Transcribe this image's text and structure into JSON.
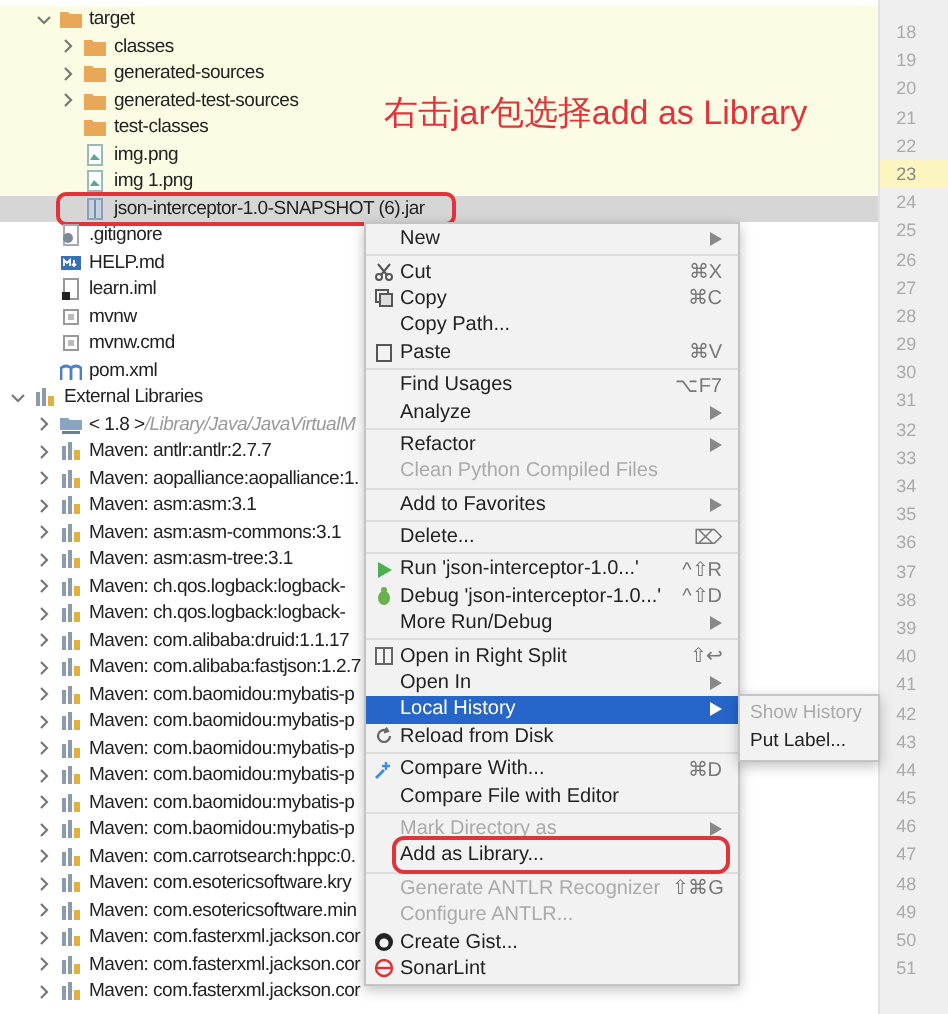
{
  "annotation": "右击jar包选择add as Library",
  "project_files": [
    {
      "label": "target",
      "kind": "folder",
      "expanded": true,
      "tinted": true,
      "selected": false,
      "children": [
        {
          "label": "classes",
          "kind": "folder",
          "expanded": false,
          "selected": false
        },
        {
          "label": "generated-sources",
          "kind": "folder",
          "expanded": false,
          "selected": false
        },
        {
          "label": "generated-test-sources",
          "kind": "folder",
          "expanded": false,
          "selected": false
        },
        {
          "label": "test-classes",
          "kind": "folder",
          "selected": false
        },
        {
          "label": "img.png",
          "kind": "image",
          "selected": false
        },
        {
          "label": "img 1.png",
          "kind": "image",
          "selected": false
        },
        {
          "label": "json-interceptor-1.0-SNAPSHOT (6).jar",
          "kind": "archive",
          "selected": true,
          "boxed": true
        }
      ]
    },
    {
      "label": ".gitignore",
      "kind": "gitignore",
      "selected": false
    },
    {
      "label": "HELP.md",
      "kind": "markdown",
      "selected": false
    },
    {
      "label": "learn.iml",
      "kind": "iml",
      "selected": false
    },
    {
      "label": "mvnw",
      "kind": "file",
      "selected": false
    },
    {
      "label": "mvnw.cmd",
      "kind": "file",
      "selected": false
    },
    {
      "label": "pom.xml",
      "kind": "maven",
      "selected": false
    }
  ],
  "external_libraries": {
    "label": "External Libraries",
    "kind": "libraries",
    "expanded": true,
    "selected": false,
    "children": [
      {
        "label": "< 1.8 >",
        "detail": "/Library/Java/JavaVirtualM",
        "kind": "jdk",
        "expanded": false,
        "selected": false
      },
      {
        "label": "Maven: antlr:antlr:2.7.7",
        "kind": "library",
        "expanded": false,
        "selected": false
      },
      {
        "label": "Maven: aopalliance:aopalliance:1.",
        "kind": "library",
        "expanded": false,
        "selected": false
      },
      {
        "label": "Maven: asm:asm:3.1",
        "kind": "library",
        "expanded": false,
        "selected": false
      },
      {
        "label": "Maven: asm:asm-commons:3.1",
        "kind": "library",
        "expanded": false,
        "selected": false
      },
      {
        "label": "Maven: asm:asm-tree:3.1",
        "kind": "library",
        "expanded": false,
        "selected": false
      },
      {
        "label": "Maven: ch.qos.logback:logback-",
        "kind": "library",
        "expanded": false,
        "selected": false
      },
      {
        "label": "Maven: ch.qos.logback:logback-",
        "kind": "library",
        "expanded": false,
        "selected": false
      },
      {
        "label": "Maven: com.alibaba:druid:1.1.17",
        "kind": "library",
        "expanded": false,
        "selected": false
      },
      {
        "label": "Maven: com.alibaba:fastjson:1.2.7",
        "kind": "library",
        "expanded": false,
        "selected": false
      },
      {
        "label": "Maven: com.baomidou:mybatis-p",
        "kind": "library",
        "expanded": false,
        "selected": false
      },
      {
        "label": "Maven: com.baomidou:mybatis-p",
        "kind": "library",
        "expanded": false,
        "selected": false
      },
      {
        "label": "Maven: com.baomidou:mybatis-p",
        "kind": "library",
        "expanded": false,
        "selected": false
      },
      {
        "label": "Maven: com.baomidou:mybatis-p",
        "kind": "library",
        "expanded": false,
        "selected": false
      },
      {
        "label": "Maven: com.baomidou:mybatis-p",
        "kind": "library",
        "expanded": false,
        "selected": false
      },
      {
        "label": "Maven: com.baomidou:mybatis-p",
        "kind": "library",
        "expanded": false,
        "selected": false
      },
      {
        "label": "Maven: com.carrotsearch:hppc:0.",
        "kind": "library",
        "expanded": false,
        "selected": false
      },
      {
        "label": "Maven: com.esotericsoftware.kry",
        "kind": "library",
        "expanded": false,
        "selected": false
      },
      {
        "label": "Maven: com.esotericsoftware.min",
        "kind": "library",
        "expanded": false,
        "selected": false
      },
      {
        "label": "Maven: com.fasterxml.jackson.cor",
        "kind": "library",
        "expanded": false,
        "selected": false
      },
      {
        "label": "Maven: com.fasterxml.jackson.cor",
        "kind": "library",
        "expanded": false,
        "selected": false
      },
      {
        "label": "Maven: com.fasterxml.jackson.cor",
        "kind": "library",
        "expanded": false,
        "selected": false
      }
    ]
  },
  "line_numbers": [
    {
      "n": "18",
      "current": false
    },
    {
      "n": "19",
      "current": false
    },
    {
      "n": "20",
      "current": false
    },
    {
      "n": "21",
      "current": false
    },
    {
      "n": "22",
      "current": false
    },
    {
      "n": "23",
      "current": true
    },
    {
      "n": "24",
      "current": false
    },
    {
      "n": "25",
      "current": false
    },
    {
      "n": "26",
      "current": false
    },
    {
      "n": "27",
      "current": false
    },
    {
      "n": "28",
      "current": false
    },
    {
      "n": "29",
      "current": false
    },
    {
      "n": "30",
      "current": false
    },
    {
      "n": "31",
      "current": false
    },
    {
      "n": "32",
      "current": false
    },
    {
      "n": "33",
      "current": false
    },
    {
      "n": "34",
      "current": false
    },
    {
      "n": "35",
      "current": false
    },
    {
      "n": "36",
      "current": false
    },
    {
      "n": "37",
      "current": false
    },
    {
      "n": "38",
      "current": false
    },
    {
      "n": "39",
      "current": false
    },
    {
      "n": "40",
      "current": false
    },
    {
      "n": "41",
      "current": false
    },
    {
      "n": "42",
      "current": false
    },
    {
      "n": "43",
      "current": false
    },
    {
      "n": "44",
      "current": false
    },
    {
      "n": "45",
      "current": false
    },
    {
      "n": "46",
      "current": false
    },
    {
      "n": "47",
      "current": false
    },
    {
      "n": "48",
      "current": false
    },
    {
      "n": "49",
      "current": false
    },
    {
      "n": "50",
      "current": false
    },
    {
      "n": "51",
      "current": false
    }
  ],
  "context_menu": [
    [
      {
        "label": "New",
        "submenu": true,
        "selected": false
      }
    ],
    [
      {
        "label": "Cut",
        "kind": "scissors",
        "shortcut": "⌘X",
        "selected": false
      },
      {
        "label": "Copy",
        "kind": "copy",
        "shortcut": "⌘C",
        "selected": false
      },
      {
        "label": "Copy Path...",
        "selected": false
      },
      {
        "label": "Paste",
        "kind": "paste",
        "shortcut": "⌘V",
        "selected": false
      }
    ],
    [
      {
        "label": "Find Usages",
        "shortcut": "⌥F7",
        "selected": false
      },
      {
        "label": "Analyze",
        "submenu": true,
        "selected": false
      }
    ],
    [
      {
        "label": "Refactor",
        "submenu": true,
        "selected": false
      },
      {
        "label": "Clean Python Compiled Files",
        "disabled": true,
        "selected": false
      }
    ],
    [
      {
        "label": "Add to Favorites",
        "submenu": true,
        "selected": false
      }
    ],
    [
      {
        "label": "Delete...",
        "shortcut": "⌦",
        "selected": false
      }
    ],
    [
      {
        "label": "Run 'json-interceptor-1.0...'",
        "kind": "run",
        "shortcut": "^⇧R",
        "selected": false
      },
      {
        "label": "Debug 'json-interceptor-1.0...'",
        "kind": "bug",
        "shortcut": "^⇧D",
        "selected": false
      },
      {
        "label": "More Run/Debug",
        "submenu": true,
        "selected": false
      }
    ],
    [
      {
        "label": "Open in Right Split",
        "kind": "split",
        "shortcut": "⇧↩",
        "selected": false
      },
      {
        "label": "Open In",
        "submenu": true,
        "selected": false
      },
      {
        "label": "Local History",
        "submenu": true,
        "selected": true
      },
      {
        "label": "Reload from Disk",
        "kind": "reload",
        "selected": false
      }
    ],
    [
      {
        "label": "Compare With...",
        "kind": "compare",
        "shortcut": "⌘D",
        "selected": false
      },
      {
        "label": "Compare File with Editor",
        "selected": false
      }
    ],
    [
      {
        "label": "Mark Directory as",
        "submenu": true,
        "disabled": true,
        "selected": false
      },
      {
        "label": "Add as Library...",
        "boxed": true,
        "selected": false
      }
    ],
    [
      {
        "label": "Generate ANTLR Recognizer",
        "shortcut": "⇧⌘G",
        "disabled": true,
        "selected": false
      },
      {
        "label": "Configure ANTLR...",
        "disabled": true,
        "selected": false
      },
      {
        "label": "Create Gist...",
        "kind": "github",
        "selected": false
      },
      {
        "label": "SonarLint",
        "kind": "sonarlint",
        "selected": false
      }
    ]
  ],
  "submenu": [
    {
      "label": "Show History",
      "disabled": true,
      "selected": false
    },
    {
      "label": "Put Label...",
      "selected": false
    }
  ]
}
